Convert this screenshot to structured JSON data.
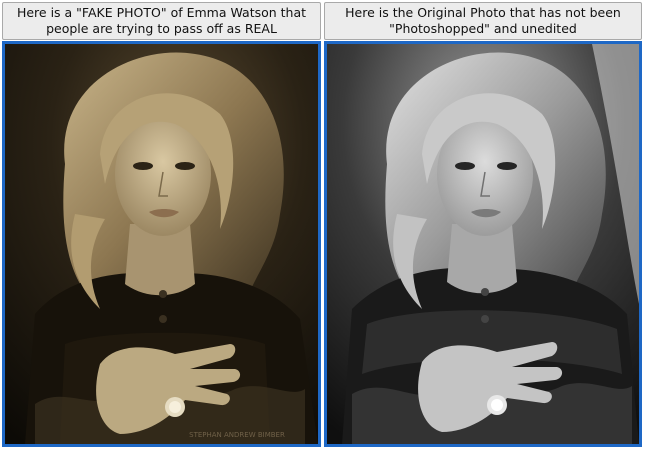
{
  "panels": [
    {
      "caption": "Here is a \"FAKE PHOTO\" of Emma Watson that people are trying to pass off as REAL",
      "photo": {
        "tone": "sepia",
        "watermark": "STEPHAN ANDREW BIMBER"
      }
    },
    {
      "caption": "Here is the Original Photo that has not been \"Photoshopped\" and unedited",
      "photo": {
        "tone": "grayscale"
      }
    }
  ],
  "colors": {
    "frame_border": "#1e68c6",
    "caption_bg": "#ececec",
    "caption_border": "#a9a9a9"
  }
}
